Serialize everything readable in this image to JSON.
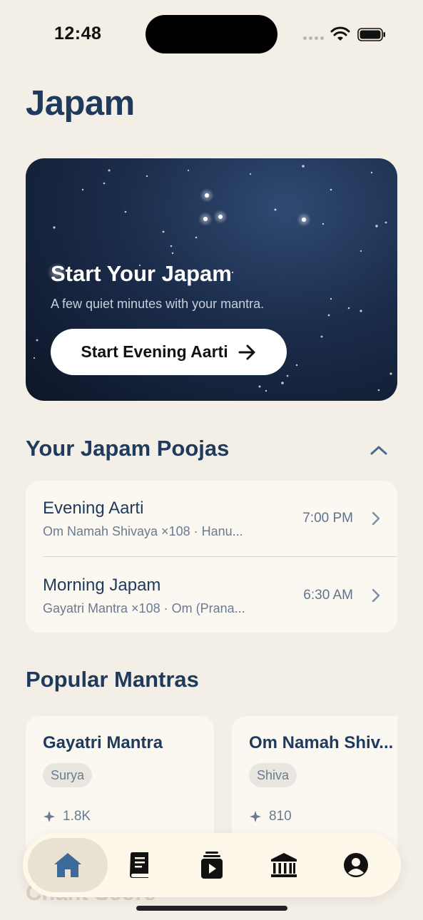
{
  "status": {
    "time": "12:48"
  },
  "page": {
    "title": "Japam"
  },
  "hero": {
    "title": "Start Your Japam",
    "subtitle": "A few quiet minutes with your mantra.",
    "button_label": "Start Evening Aarti"
  },
  "poojas": {
    "title": "Your Japam Poojas",
    "items": [
      {
        "name": "Evening Aarti",
        "desc": "Om Namah Shivaya ×108 · Hanu...",
        "time": "7:00 PM"
      },
      {
        "name": "Morning Japam",
        "desc": "Gayatri Mantra ×108 · Om (Prana...",
        "time": "6:30 AM"
      }
    ]
  },
  "mantras": {
    "title": "Popular Mantras",
    "items": [
      {
        "name": "Gayatri Mantra",
        "tag": "Surya",
        "count": "1.8K"
      },
      {
        "name": "Om Namah Shiv...",
        "tag": "Shiva",
        "count": "810"
      }
    ]
  },
  "next_section": {
    "title": "Chant Score"
  },
  "tabs": [
    {
      "icon": "home-icon",
      "active": true
    },
    {
      "icon": "book-icon",
      "active": false
    },
    {
      "icon": "video-icon",
      "active": false
    },
    {
      "icon": "temple-icon",
      "active": false
    },
    {
      "icon": "profile-icon",
      "active": false
    }
  ],
  "colors": {
    "background": "#f4efe6",
    "accent": "#1f3a5c",
    "card": "#fbf8f1"
  }
}
